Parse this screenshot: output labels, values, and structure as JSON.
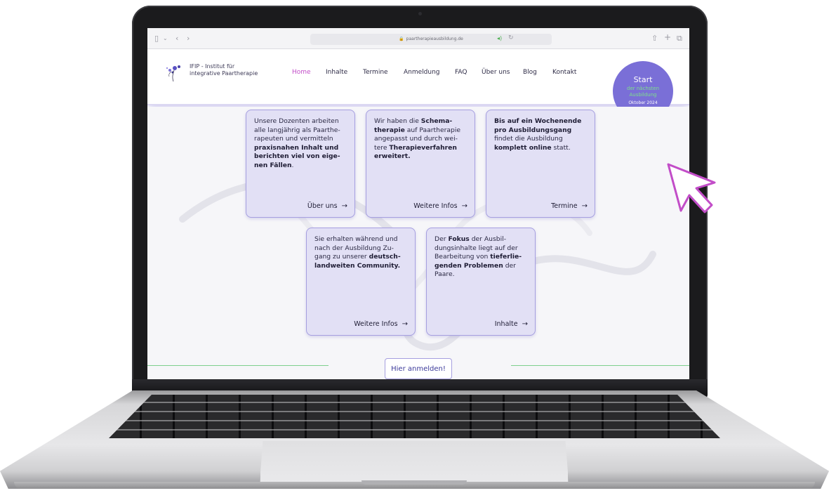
{
  "browser": {
    "url": "paartherapieausbildung.de",
    "icons": [
      "sidebar-icon",
      "chevron-back-icon",
      "chevron-forward-icon",
      "audio-icon",
      "reload-icon",
      "share-icon",
      "new-tab-icon",
      "tabs-icon"
    ]
  },
  "header": {
    "logo_line1": "IFIP - Institut für",
    "logo_line2": "integrative Paartherapie",
    "nav": [
      "Home",
      "Inhalte",
      "Termine",
      "Anmeldung",
      "FAQ",
      "Über uns",
      "Blog",
      "Kontakt"
    ],
    "active_nav": "Home",
    "start_badge": {
      "title": "Start",
      "line2": "der nächsten",
      "line3": "Ausbildung",
      "date": "Oktober 2024"
    }
  },
  "cards": [
    {
      "html_segments": [
        {
          "t": "Unsere Dozenten arbeiten alle langjährig als Paarthe-rapeuten und vermitteln ",
          "b": false
        },
        {
          "t": "praxisnahen Inhalt und berichten viel von eige-nen Fällen",
          "b": true
        },
        {
          "t": ".",
          "b": false
        }
      ],
      "link": "Über uns"
    },
    {
      "html_segments": [
        {
          "t": "Wir haben die ",
          "b": false
        },
        {
          "t": "Schema-therapie",
          "b": true
        },
        {
          "t": " auf Paartherapie angepasst und durch wei-tere ",
          "b": false
        },
        {
          "t": "Therapieverfahren erweitert.",
          "b": true
        }
      ],
      "link": "Weitere Infos"
    },
    {
      "html_segments": [
        {
          "t": "Bis auf ein Wochenende pro Ausbildungsgang",
          "b": true
        },
        {
          "t": " findet die Ausbildung ",
          "b": false
        },
        {
          "t": "komplett online",
          "b": true
        },
        {
          "t": " statt.",
          "b": false
        }
      ],
      "link": "Termine"
    },
    {
      "html_segments": [
        {
          "t": "Sie erhalten während und nach der Ausbildung Zu-gang zu unserer ",
          "b": false
        },
        {
          "t": "deutsch-landweiten Community.",
          "b": true
        }
      ],
      "link": "Weitere Infos"
    },
    {
      "html_segments": [
        {
          "t": "Der ",
          "b": false
        },
        {
          "t": "Fokus",
          "b": true
        },
        {
          "t": " der Ausbil-dungsinhalte liegt auf der Bearbeitung von ",
          "b": false
        },
        {
          "t": "tieferlie-genden Problemen",
          "b": true
        },
        {
          "t": " der Paare.",
          "b": false
        }
      ],
      "link": "Inhalte"
    }
  ],
  "cta": {
    "label": "Hier anmelden!"
  },
  "colors": {
    "accent_purple": "#7a6fd7",
    "card_bg": "#e2e0f5",
    "card_border": "#a69fe0",
    "active_nav": "#c24dc8",
    "badge_green": "#7ee08a",
    "cursor": "#c24dc8"
  }
}
